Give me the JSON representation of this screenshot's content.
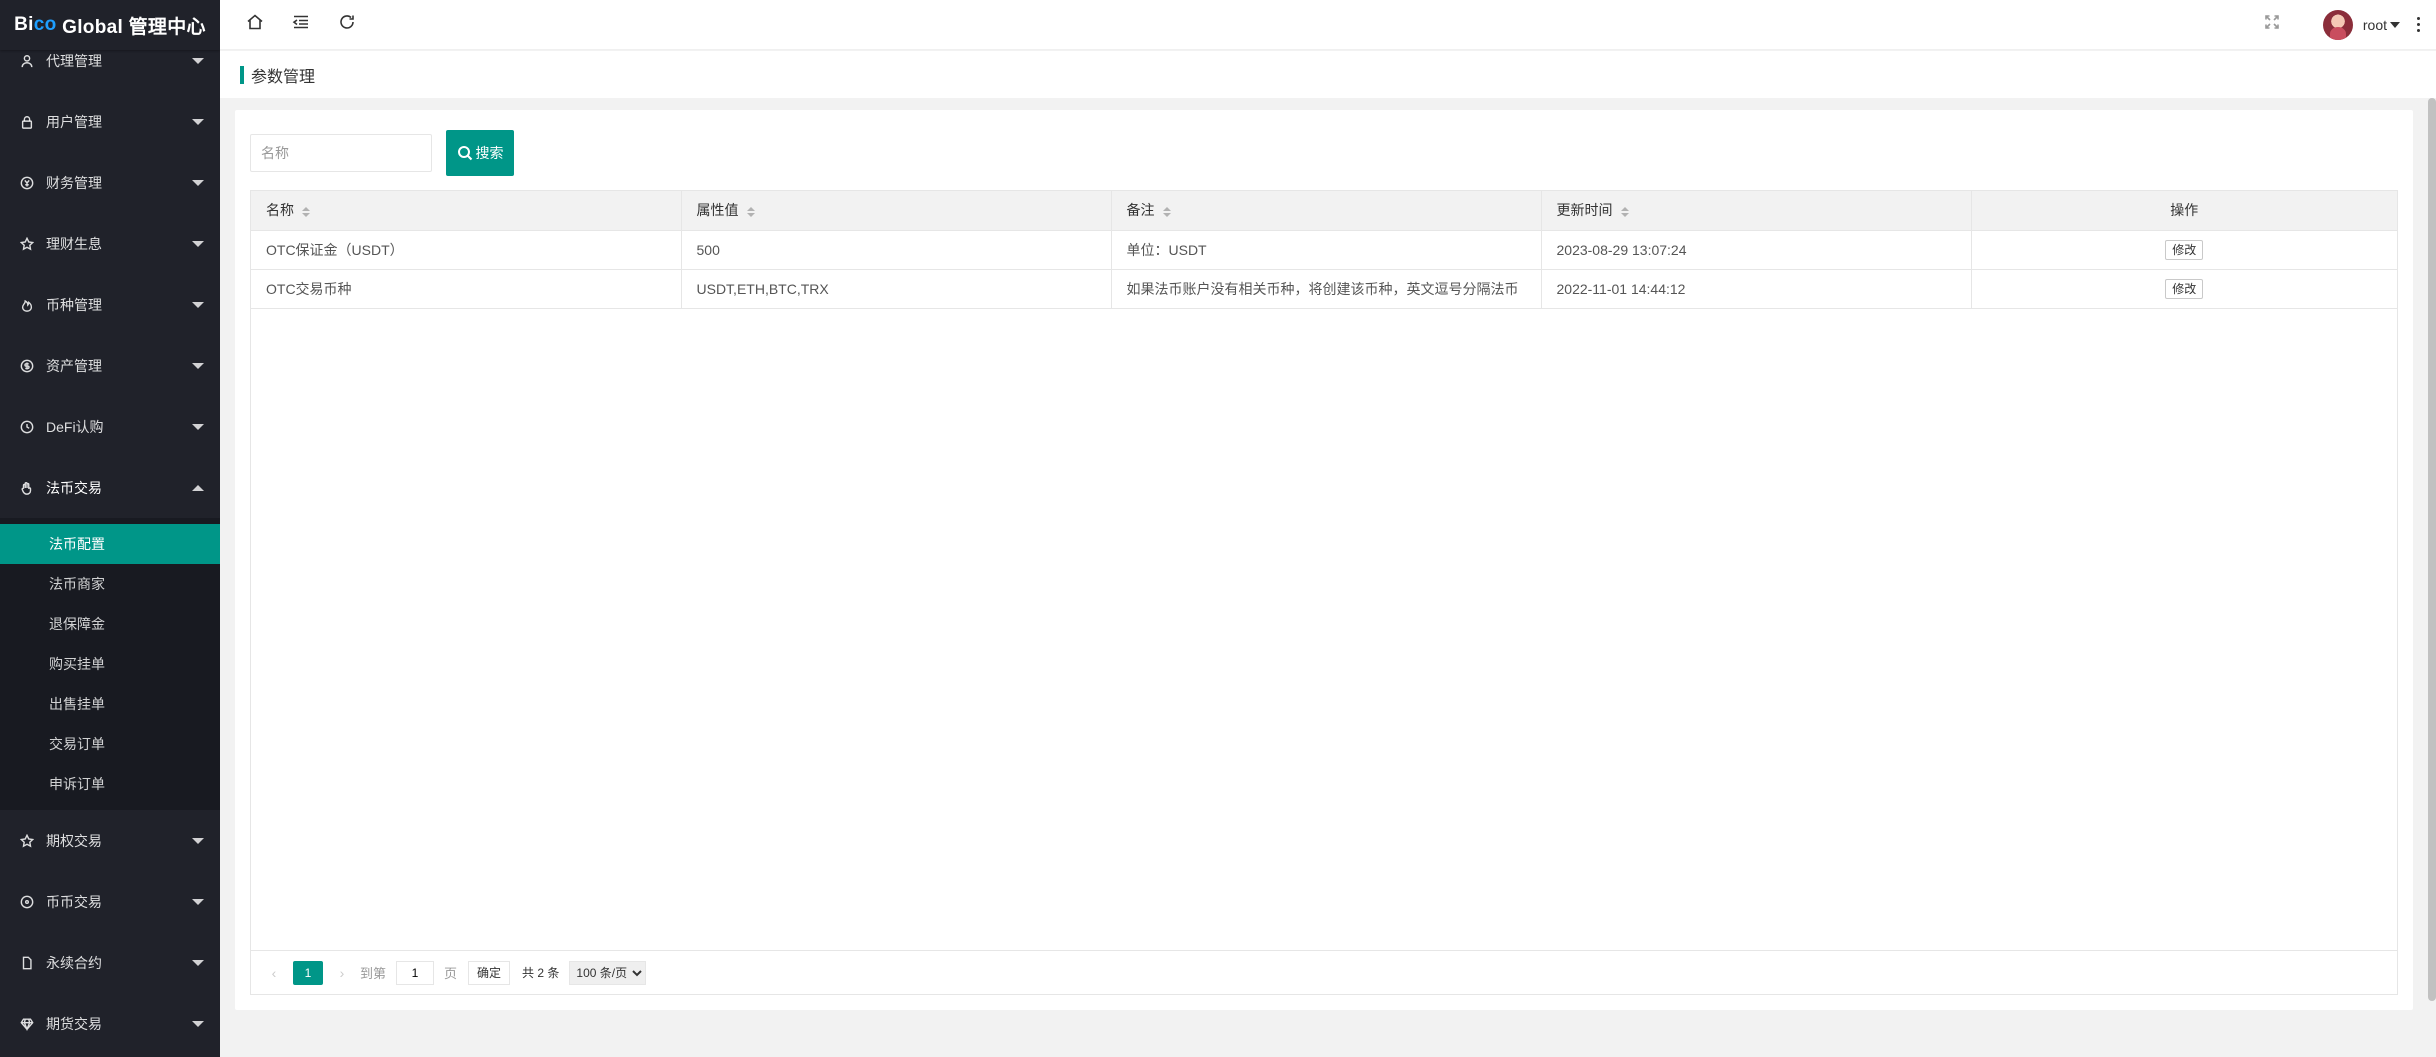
{
  "logo": {
    "part1": "Bi",
    "part2": "co",
    "part3": " Global 管理中心"
  },
  "sidebar": {
    "items_top": [
      {
        "label": "代理管理",
        "icon": "user-icon"
      },
      {
        "label": "用户管理",
        "icon": "lock-icon"
      },
      {
        "label": "财务管理",
        "icon": "coin-icon"
      },
      {
        "label": "理财生息",
        "icon": "star-icon"
      },
      {
        "label": "币种管理",
        "icon": "fire-icon"
      },
      {
        "label": "资产管理",
        "icon": "dollar-icon"
      },
      {
        "label": "DeFi认购",
        "icon": "clock-icon"
      },
      {
        "label": "法币交易",
        "icon": "hand-icon"
      }
    ],
    "submenu": [
      "法币配置",
      "法币商家",
      "退保障金",
      "购买挂单",
      "出售挂单",
      "交易订单",
      "申诉订单"
    ],
    "submenu_active": "法币配置",
    "items_bottom": [
      {
        "label": "期权交易",
        "icon": "star-icon"
      },
      {
        "label": "币币交易",
        "icon": "circle-icon"
      },
      {
        "label": "永续合约",
        "icon": "file-icon"
      },
      {
        "label": "期货交易",
        "icon": "diamond-icon"
      }
    ]
  },
  "header": {
    "username": "root"
  },
  "page": {
    "title": "参数管理"
  },
  "search": {
    "placeholder": "名称",
    "button_label": "搜索"
  },
  "table": {
    "columns": [
      "名称",
      "属性值",
      "备注",
      "更新时间",
      "操作"
    ],
    "rows": [
      {
        "name": "OTC保证金（USDT）",
        "value": "500",
        "remark": "单位：USDT",
        "updated": "2023-08-29 13:07:24",
        "action": "修改"
      },
      {
        "name": "OTC交易币种",
        "value": "USDT,ETH,BTC,TRX",
        "remark": "如果法币账户没有相关币种，将创建该币种，英文逗号分隔法币",
        "updated": "2022-11-01 14:44:12",
        "action": "修改"
      }
    ]
  },
  "pager": {
    "current": "1",
    "goto_label": "到第",
    "page_input": "1",
    "page_unit": "页",
    "ok_label": "确定",
    "total": "共 2 条",
    "page_size": "100 条/页"
  },
  "colors": {
    "accent": "#009688",
    "sidebar_bg": "#20222a",
    "submenu_bg": "#181a21"
  }
}
